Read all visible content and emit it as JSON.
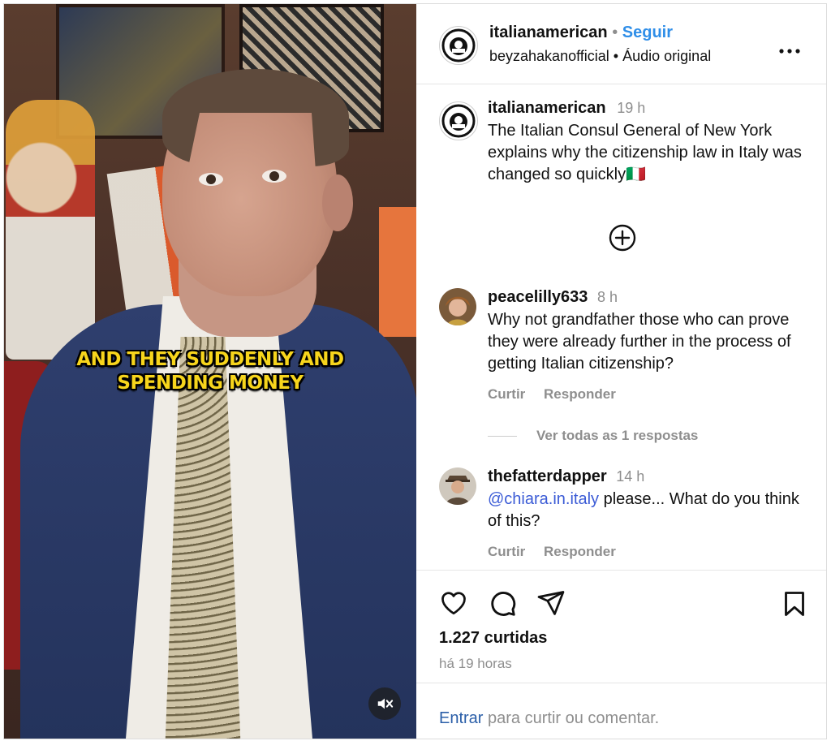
{
  "video": {
    "caption_line1": "AND THEY SUDDENLY AND",
    "caption_line2": "SPENDING MONEY"
  },
  "header": {
    "username": "italianamerican",
    "separator": "•",
    "follow_label": "Seguir",
    "audio_user": "beyzahakanofficial",
    "audio_label": "Áudio original",
    "more_label": "•••"
  },
  "post": {
    "username": "italianamerican",
    "time": "19 h",
    "text": "The Italian Consul General of New York explains why the citizenship law in Italy was changed so quickly",
    "flag": "🇮🇹"
  },
  "comments": [
    {
      "username": "peacelilly633",
      "time": "8 h",
      "text": "Why not grandfather those who can prove they were already further in the process of getting Italian citizenship?",
      "like_label": "Curtir",
      "reply_label": "Responder",
      "view_replies": "Ver todas as 1 respostas"
    },
    {
      "username": "thefatterdapper",
      "time": "14 h",
      "mention": "@chiara.in.italy",
      "text": " please... What do you think of this?",
      "like_label": "Curtir",
      "reply_label": "Responder"
    }
  ],
  "footer": {
    "likes": "1.227 curtidas",
    "posted": "há 19 horas",
    "login_link": "Entrar",
    "login_text": " para curtir ou comentar."
  },
  "colors": {
    "accent_blue": "#2f8ee8",
    "login_link": "#2a5ea8",
    "mention": "#3b5bd6",
    "muted": "#8e8e8e",
    "caption": "#f7d51c"
  }
}
